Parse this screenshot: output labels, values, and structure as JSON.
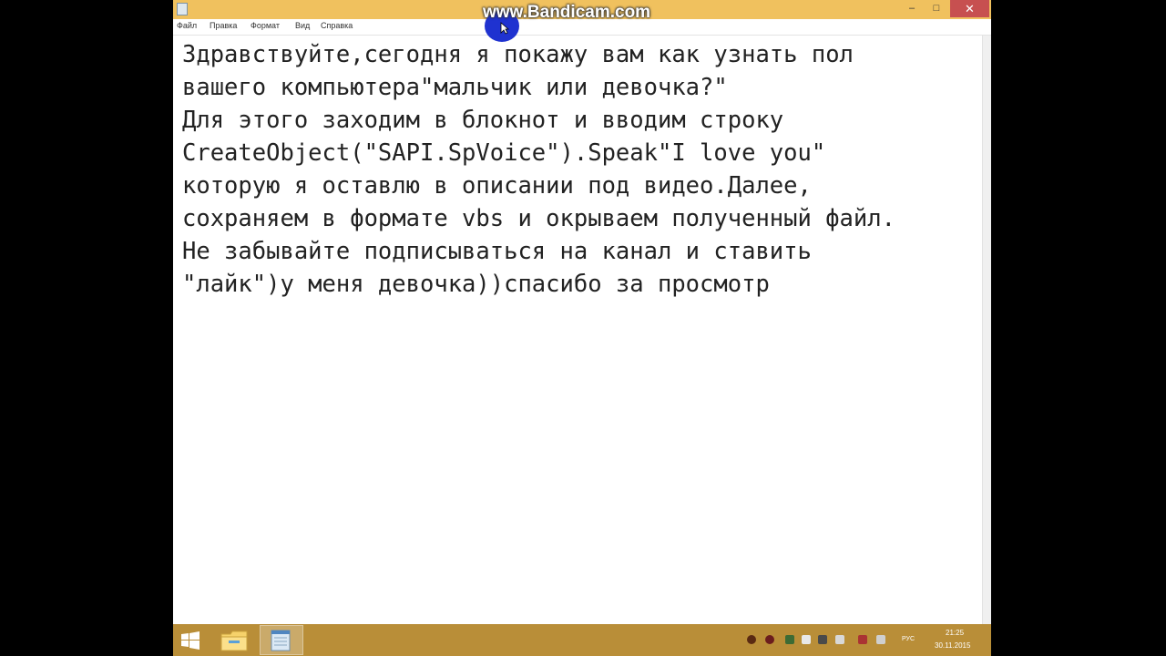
{
  "watermark": "www.Bandicam.com",
  "window": {
    "controls": {
      "minimize": "–",
      "maximize": "□",
      "close": "✕"
    }
  },
  "menu": {
    "items": [
      "Файл",
      "Правка",
      "Формат",
      "Вид",
      "Справка"
    ]
  },
  "document": {
    "text": "Здравствуйте,сегодня я покажу вам как узнать пол\nвашего компьютера\"мальчик или девочка?\"\nДля этого заходим в блокнот и вводим строку\nCreateObject(\"SAPI.SpVoice\").Speak\"I love you\"\nкоторую я оставлю в описании под видео.Далее,\nсохраняем в формате vbs и окрываем полученный файл.\nНе забывайте подписываться на канал и ставить\n\"лайк\")у меня девочка))спасибо за просмотр"
  },
  "taskbar": {
    "language": "РУС",
    "time": "21:25",
    "date": "30.11.2015",
    "icons": [
      "windows-start-icon",
      "file-explorer-icon",
      "notepad-icon"
    ]
  },
  "colors": {
    "titlebar": "#f0c15e",
    "taskbar": "#b98e38",
    "close_button": "#c75050",
    "cursor_highlight": "#1f32d0"
  }
}
